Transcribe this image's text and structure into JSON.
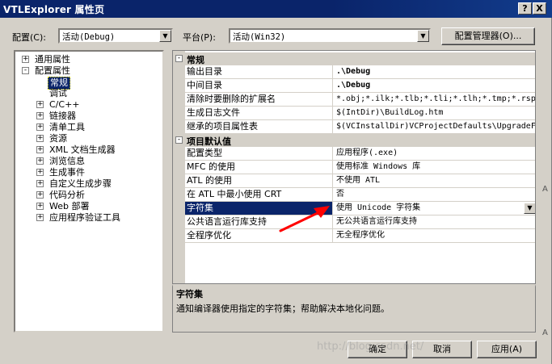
{
  "window": {
    "title": "VTLExplorer 属性页",
    "help_button": "?",
    "close_button": "X"
  },
  "toolbar": {
    "config_label": "配置(C):",
    "config_value": "活动(Debug)",
    "platform_label": "平台(P):",
    "platform_value": "活动(Win32)",
    "config_manager_button": "配置管理器(O)..."
  },
  "tree": {
    "items": [
      {
        "label": "通用属性",
        "expander": "+"
      },
      {
        "label": "配置属性",
        "expander": "-"
      },
      {
        "label": "常规",
        "expander": ""
      },
      {
        "label": "调试",
        "expander": ""
      },
      {
        "label": "C/C++",
        "expander": "+"
      },
      {
        "label": "链接器",
        "expander": "+"
      },
      {
        "label": "清单工具",
        "expander": "+"
      },
      {
        "label": "资源",
        "expander": "+"
      },
      {
        "label": "XML 文档生成器",
        "expander": "+"
      },
      {
        "label": "浏览信息",
        "expander": "+"
      },
      {
        "label": "生成事件",
        "expander": "+"
      },
      {
        "label": "自定义生成步骤",
        "expander": "+"
      },
      {
        "label": "代码分析",
        "expander": "+"
      },
      {
        "label": "Web 部署",
        "expander": "+"
      },
      {
        "label": "应用程序验证工具",
        "expander": "+"
      }
    ]
  },
  "grid": {
    "categories": [
      {
        "title": "常规",
        "toggle": "-"
      },
      {
        "title": "项目默认值",
        "toggle": "-"
      }
    ],
    "general_rows": [
      {
        "name": "输出目录",
        "value": ".\\Debug"
      },
      {
        "name": "中间目录",
        "value": ".\\Debug"
      },
      {
        "name": "清除时要删除的扩展名",
        "value": "*.obj;*.ilk;*.tlb;*.tli;*.tlh;*.tmp;*.rsp"
      },
      {
        "name": "生成日志文件",
        "value": "$(IntDir)\\BuildLog.htm"
      },
      {
        "name": "继承的项目属性表",
        "value": "$(VCInstallDir)VCProjectDefaults\\UpgradeFr"
      }
    ],
    "default_rows": [
      {
        "name": "配置类型",
        "value": "应用程序(.exe)"
      },
      {
        "name": "MFC 的使用",
        "value": "使用标准 Windows 库"
      },
      {
        "name": "ATL 的使用",
        "value": "不使用 ATL"
      },
      {
        "name": "在 ATL 中最小使用 CRT",
        "value": "否"
      },
      {
        "name": "字符集",
        "value": "使用 Unicode 字符集"
      },
      {
        "name": "公共语言运行库支持",
        "value": "无公共语言运行库支持"
      },
      {
        "name": "全程序优化",
        "value": "无全程序优化"
      }
    ]
  },
  "description": {
    "title": "字符集",
    "text": "通知编译器使用指定的字符集；帮助解决本地化问题。"
  },
  "buttons": {
    "ok": "确定",
    "cancel": "取消",
    "apply": "应用(A)"
  },
  "watermark": "http://blog.csdn.net/",
  "edge_chars": [
    "A",
    "A"
  ],
  "colors": {
    "titlebar": "#0a246a",
    "selection": "#0a246a",
    "annotation_arrow": "#ff0000"
  }
}
